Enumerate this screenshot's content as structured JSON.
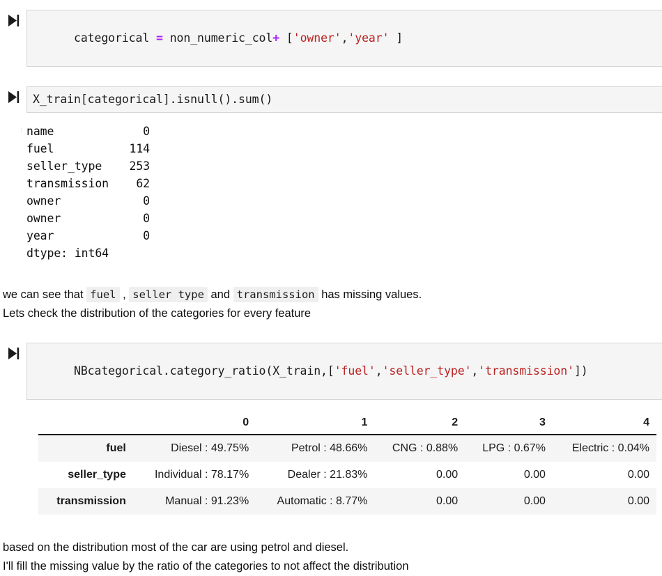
{
  "icons": {
    "run_cell": "run-cell-icon"
  },
  "cells": [
    {
      "id": "cell-1",
      "prompt_icon": "run-cell-icon",
      "code_tokens": [
        {
          "t": "categorical ",
          "k": "plain"
        },
        {
          "t": "=",
          "k": "op"
        },
        {
          "t": " non_numeric_col",
          "k": "plain"
        },
        {
          "t": "+",
          "k": "op"
        },
        {
          "t": " [",
          "k": "pun"
        },
        {
          "t": "'owner'",
          "k": "str"
        },
        {
          "t": ",",
          "k": "pun"
        },
        {
          "t": "'year'",
          "k": "str"
        },
        {
          "t": " ]",
          "k": "pun"
        }
      ],
      "code_plain": "categorical = non_numeric_col+ ['owner','year' ]"
    },
    {
      "id": "cell-2",
      "prompt_icon": "run-cell-icon",
      "code_tokens": [
        {
          "t": "X_train[categorical].isnull().sum()",
          "k": "plain"
        }
      ],
      "code_plain": "X_train[categorical].isnull().sum()"
    },
    {
      "id": "cell-3",
      "prompt_icon": "run-cell-icon",
      "code_tokens": [
        {
          "t": "NBcategorical.category_ratio(X_train,[",
          "k": "plain"
        },
        {
          "t": "'fuel'",
          "k": "str"
        },
        {
          "t": ",",
          "k": "pun"
        },
        {
          "t": "'seller_type'",
          "k": "str"
        },
        {
          "t": ",",
          "k": "pun"
        },
        {
          "t": "'transmission'",
          "k": "str"
        },
        {
          "t": "])",
          "k": "pun"
        }
      ],
      "code_plain": "NBcategorical.category_ratio(X_train,['fuel','seller_type','transmission'])"
    }
  ],
  "series_output": {
    "prompt": ":",
    "rows": [
      {
        "label": "name",
        "value": "0"
      },
      {
        "label": "fuel",
        "value": "114"
      },
      {
        "label": "seller_type",
        "value": "253"
      },
      {
        "label": "transmission",
        "value": "62"
      },
      {
        "label": "owner",
        "value": "0"
      },
      {
        "label": "owner",
        "value": "0"
      },
      {
        "label": "year",
        "value": "0"
      }
    ],
    "dtype_line": "dtype: int64",
    "text": "name             0\nfuel           114\nseller_type    253\ntransmission    62\nowner            0\nowner            0\nyear             0\ndtype: int64"
  },
  "markdown_top": {
    "line1_part1": "we can see that ",
    "line1_code1": "fuel",
    "line1_part2": " , ",
    "line1_code2": "seller type",
    "line1_part3": " and ",
    "line1_code3": "transmission",
    "line1_part4": " has missing values.",
    "line2": "Lets check the distribution of the categories for every feature"
  },
  "dataframe": {
    "index_header": "",
    "columns": [
      "0",
      "1",
      "2",
      "3",
      "4"
    ],
    "rows": [
      {
        "index": "fuel",
        "cells": [
          "Diesel : 49.75%",
          "Petrol : 48.66%",
          "CNG : 0.88%",
          "LPG : 0.67%",
          "Electric : 0.04%"
        ]
      },
      {
        "index": "seller_type",
        "cells": [
          "Individual : 78.17%",
          "Dealer : 21.83%",
          "0.00",
          "0.00",
          "0.00"
        ]
      },
      {
        "index": "transmission",
        "cells": [
          "Manual : 91.23%",
          "Automatic : 8.77%",
          "0.00",
          "0.00",
          "0.00"
        ]
      }
    ]
  },
  "markdown_bottom": {
    "line1": "based on the distribution most of the car are using petrol and diesel.",
    "line2": "I'll fill the missing value by the ratio of the categories to not affect the distribution"
  },
  "colors": {
    "cell_background": "#f5f5f5",
    "cell_border": "#d6d6d6",
    "string_token": "#ba2121",
    "operator_token": "#aa22ff",
    "table_stripe": "#f5f5f5",
    "table_rule": "#111111",
    "text": "#0d0d0d"
  }
}
